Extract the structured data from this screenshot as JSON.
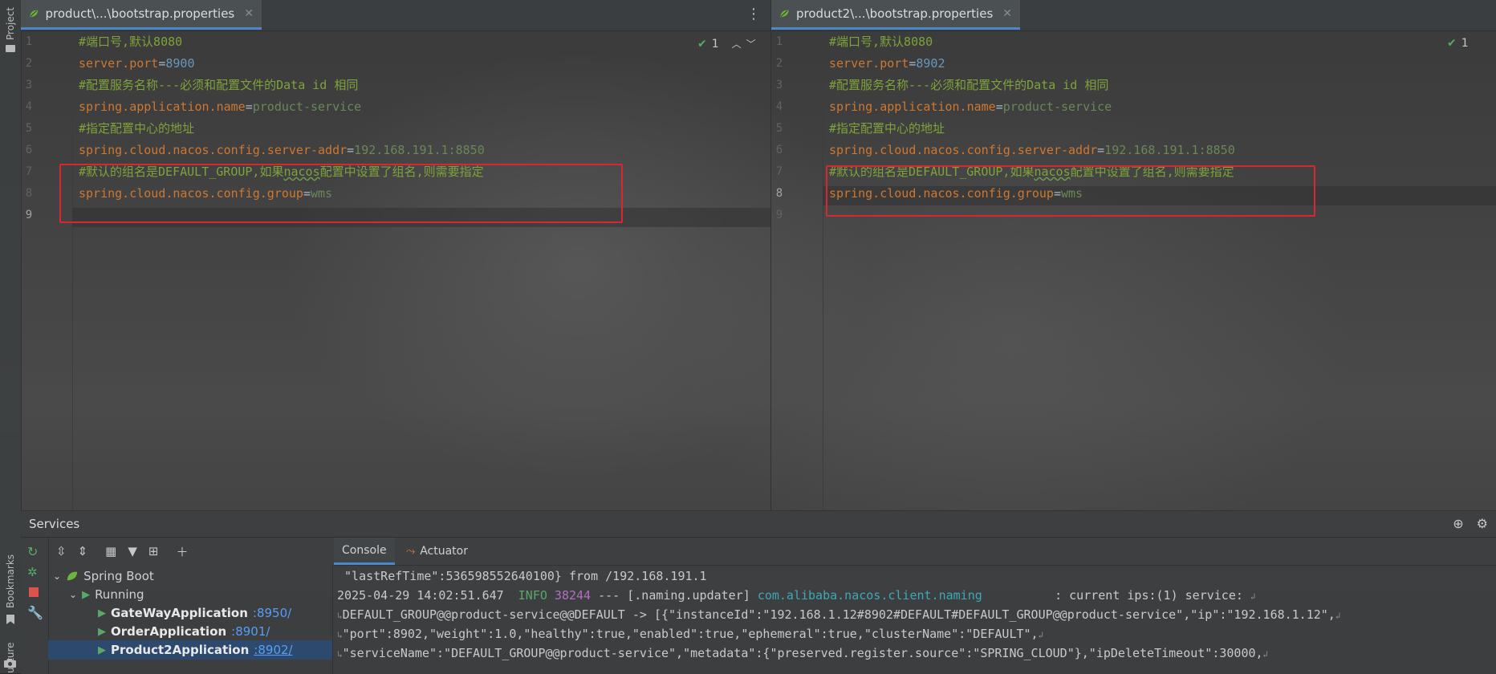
{
  "left_strip": {
    "project_label": "Project",
    "bookmarks_label": "Bookmarks",
    "structure_label": "ucture"
  },
  "left_editor": {
    "tab_title": "product\\...\\bootstrap.properties",
    "inspection_count": "1",
    "line_numbers": [
      "1",
      "2",
      "3",
      "4",
      "5",
      "6",
      "7",
      "8",
      "9"
    ],
    "lines": {
      "l1": "#端口号,默认8080",
      "l2_key": "server.port",
      "l2_val": "8900",
      "l3": "#配置服务名称---必须和配置文件的Data id 相同",
      "l4_key": "spring.application.name",
      "l4_val": "product-service",
      "l5": "#指定配置中心的地址",
      "l6_key": "spring.cloud.nacos.config.server-addr",
      "l6_val": "192.168.191.1:8850",
      "l7_a": "#默认的组名是DEFAULT_GROUP,如果",
      "l7_b": "nacos",
      "l7_c": "配置中设置了组名,则需要指定",
      "l8_key": "spring.cloud.nacos.config.group",
      "l8_val": "wms"
    }
  },
  "right_editor": {
    "tab_title": "product2\\...\\bootstrap.properties",
    "inspection_count": "1",
    "line_numbers": [
      "1",
      "2",
      "3",
      "4",
      "5",
      "6",
      "7",
      "8",
      "9"
    ],
    "lines": {
      "l1": "#端口号,默认8080",
      "l2_key": "server.port",
      "l2_val": "8902",
      "l3": "#配置服务名称---必须和配置文件的Data id 相同",
      "l4_key": "spring.application.name",
      "l4_val": "product-service",
      "l5": "#指定配置中心的地址",
      "l6_key": "spring.cloud.nacos.config.server-addr",
      "l6_val": "192.168.191.1:8850",
      "l7_a": "#默认的组名是DEFAULT_GROUP,如果",
      "l7_b": "nacos",
      "l7_c": "配置中设置了组名,则需要指定",
      "l8_key": "spring.cloud.nacos.config.group",
      "l8_val": "wms"
    }
  },
  "eq": "=",
  "services": {
    "title": "Services",
    "tree": {
      "root": "Spring Boot",
      "group": "Running",
      "apps": [
        {
          "name": "GateWayApplication",
          "port": ":8950/"
        },
        {
          "name": "OrderApplication",
          "port": ":8901/"
        },
        {
          "name": "Product2Application",
          "port": ":8902/"
        }
      ]
    },
    "tabs": {
      "console": "Console",
      "actuator": "Actuator"
    },
    "console": {
      "line1": " \"lastRefTime\":536598552640100} from /192.168.191.1",
      "line2_ts": "2025-04-29 14:02:51.647  ",
      "line2_level": "INFO",
      "line2_pid": " 38244",
      "line2_mid": " --- [.naming.updater] ",
      "line2_logger": "com.alibaba.nacos.client.naming",
      "line2_msg": "          : current ips:(1) service: ",
      "line3": "DEFAULT_GROUP@@product-service@@DEFAULT -> [{\"instanceId\":\"192.168.1.12#8902#DEFAULT#DEFAULT_GROUP@@product-service\",\"ip\":\"192.168.1.12\",",
      "line4": "\"port\":8902,\"weight\":1.0,\"healthy\":true,\"enabled\":true,\"ephemeral\":true,\"clusterName\":\"DEFAULT\",",
      "line5": "\"serviceName\":\"DEFAULT_GROUP@@product-service\",\"metadata\":{\"preserved.register.source\":\"SPRING_CLOUD\"},\"ipDeleteTimeout\":30000,"
    }
  }
}
